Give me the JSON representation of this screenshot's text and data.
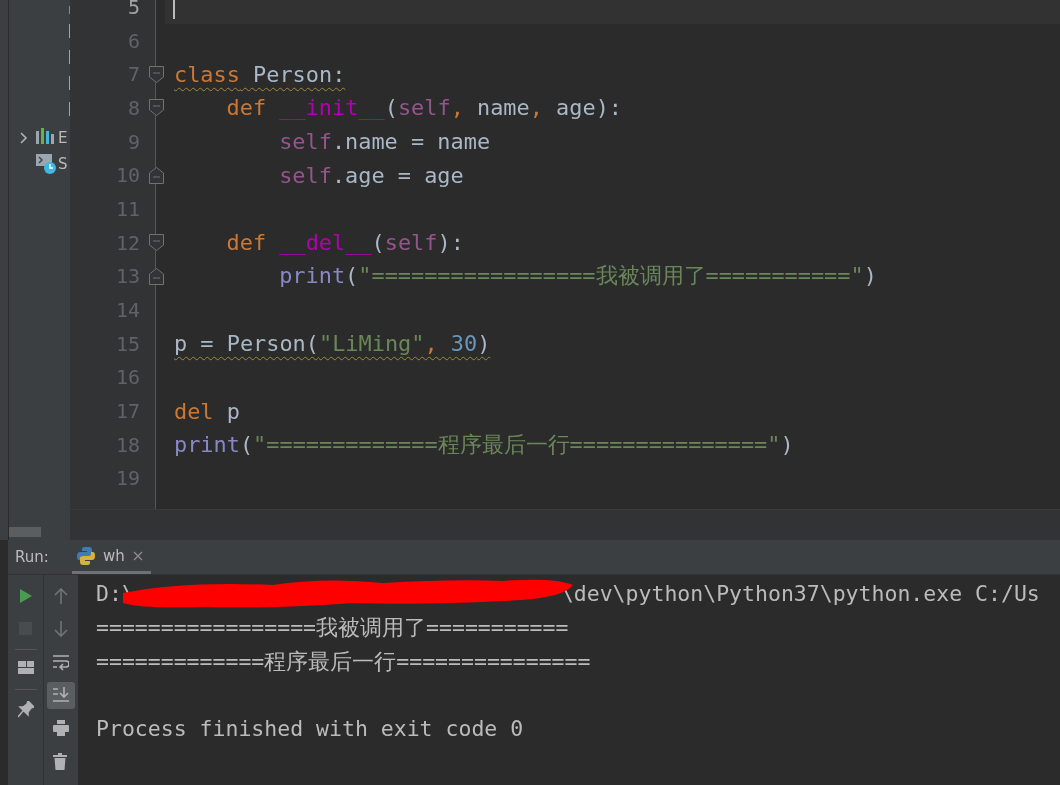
{
  "project_panel": {
    "items": [
      {
        "label": "E",
        "kind": "libraries",
        "expanded": false
      },
      {
        "label": "S",
        "kind": "scratches"
      }
    ]
  },
  "editor": {
    "lines": [
      {
        "number": "5",
        "current": true,
        "caret": true
      },
      {
        "number": "6"
      },
      {
        "number": "7",
        "fold_start": true,
        "warning": true,
        "tokens": [
          {
            "text": "class",
            "kind": "keyword"
          },
          {
            "text": " Person:",
            "kind": "plain"
          }
        ],
        "children": [
          {
            "number": "8",
            "fold_start": true,
            "tokens": [
              {
                "text": "def ",
                "kind": "keyword"
              },
              {
                "text": "__init__",
                "kind": "dunder"
              },
              {
                "text": "(",
                "kind": "plain"
              },
              {
                "text": "self",
                "kind": "self"
              },
              {
                "text": ", ",
                "kind": "keyword"
              },
              {
                "text": "name",
                "kind": "plain"
              },
              {
                "text": ", ",
                "kind": "keyword"
              },
              {
                "text": "age):",
                "kind": "plain"
              }
            ],
            "children": [
              {
                "number": "9",
                "tokens": [
                  {
                    "text": "self",
                    "kind": "self"
                  },
                  {
                    "text": ".name = name",
                    "kind": "plain"
                  }
                ]
              },
              {
                "number": "10",
                "fold_end": true,
                "tokens": [
                  {
                    "text": "self",
                    "kind": "self"
                  },
                  {
                    "text": ".age = age",
                    "kind": "plain"
                  }
                ]
              }
            ]
          },
          {
            "number": "11"
          },
          {
            "number": "12",
            "fold_start": true,
            "tokens": [
              {
                "text": "def ",
                "kind": "keyword"
              },
              {
                "text": "__del__",
                "kind": "dunder"
              },
              {
                "text": "(",
                "kind": "plain"
              },
              {
                "text": "self",
                "kind": "self"
              },
              {
                "text": "):",
                "kind": "plain"
              }
            ],
            "children": [
              {
                "number": "13",
                "fold_end": true,
                "tokens": [
                  {
                    "text": "print",
                    "kind": "builtin"
                  },
                  {
                    "text": "(",
                    "kind": "plain"
                  },
                  {
                    "text": "\"=================我被调用了===========\"",
                    "kind": "string"
                  },
                  {
                    "text": ")",
                    "kind": "plain"
                  }
                ]
              }
            ]
          }
        ]
      },
      {
        "number": "14"
      },
      {
        "number": "15",
        "warning": true,
        "tokens": [
          {
            "text": "p = Person(",
            "kind": "plain"
          },
          {
            "text": "\"LiMing\"",
            "kind": "string"
          },
          {
            "text": ", ",
            "kind": "keyword"
          },
          {
            "text": "30",
            "kind": "number"
          },
          {
            "text": ")",
            "kind": "plain"
          }
        ]
      },
      {
        "number": "16"
      },
      {
        "number": "17",
        "tokens": [
          {
            "text": "del",
            "kind": "keyword"
          },
          {
            "text": " p",
            "kind": "plain"
          }
        ]
      },
      {
        "number": "18",
        "tokens": [
          {
            "text": "print",
            "kind": "builtin"
          },
          {
            "text": "(",
            "kind": "plain"
          },
          {
            "text": "\"=============程序最后一行===============\"",
            "kind": "string"
          },
          {
            "text": ")",
            "kind": "plain"
          }
        ]
      },
      {
        "number": "19"
      }
    ]
  },
  "run_panel": {
    "label": "Run:",
    "tabs": [
      {
        "label": "wh",
        "selected": true
      }
    ],
    "toolbar": [
      {
        "kind": "run",
        "disabled": false
      },
      {
        "kind": "stop",
        "disabled": true
      },
      {
        "kind": "layout",
        "disabled": false
      },
      {
        "kind": "pin",
        "disabled": false
      }
    ],
    "toolbar_2": [
      {
        "kind": "up",
        "disabled": true,
        "selected": false
      },
      {
        "kind": "down",
        "disabled": true,
        "selected": false
      },
      {
        "kind": "wrap",
        "disabled": false,
        "selected": false
      },
      {
        "kind": "scroll-end",
        "disabled": false,
        "selected": true
      },
      {
        "kind": "print",
        "disabled": false,
        "selected": false
      },
      {
        "kind": "trash",
        "disabled": false,
        "selected": false
      }
    ],
    "output": [
      {
        "kind": "text",
        "segments": [
          {
            "kind": "text",
            "text": "D:\\"
          },
          {
            "kind": "redaction"
          },
          {
            "kind": "text",
            "text": "\\dev\\python\\Python37\\python.exe C:/Us"
          }
        ]
      },
      {
        "kind": "text",
        "segments": [
          {
            "kind": "text",
            "text": "=================我被调用了==========="
          }
        ]
      },
      {
        "kind": "text",
        "segments": [
          {
            "kind": "text",
            "text": "=============程序最后一行==============="
          }
        ]
      },
      {
        "kind": "blank"
      },
      {
        "kind": "text",
        "segments": [
          {
            "kind": "text",
            "text": "Process finished with exit code 0"
          }
        ]
      }
    ]
  }
}
